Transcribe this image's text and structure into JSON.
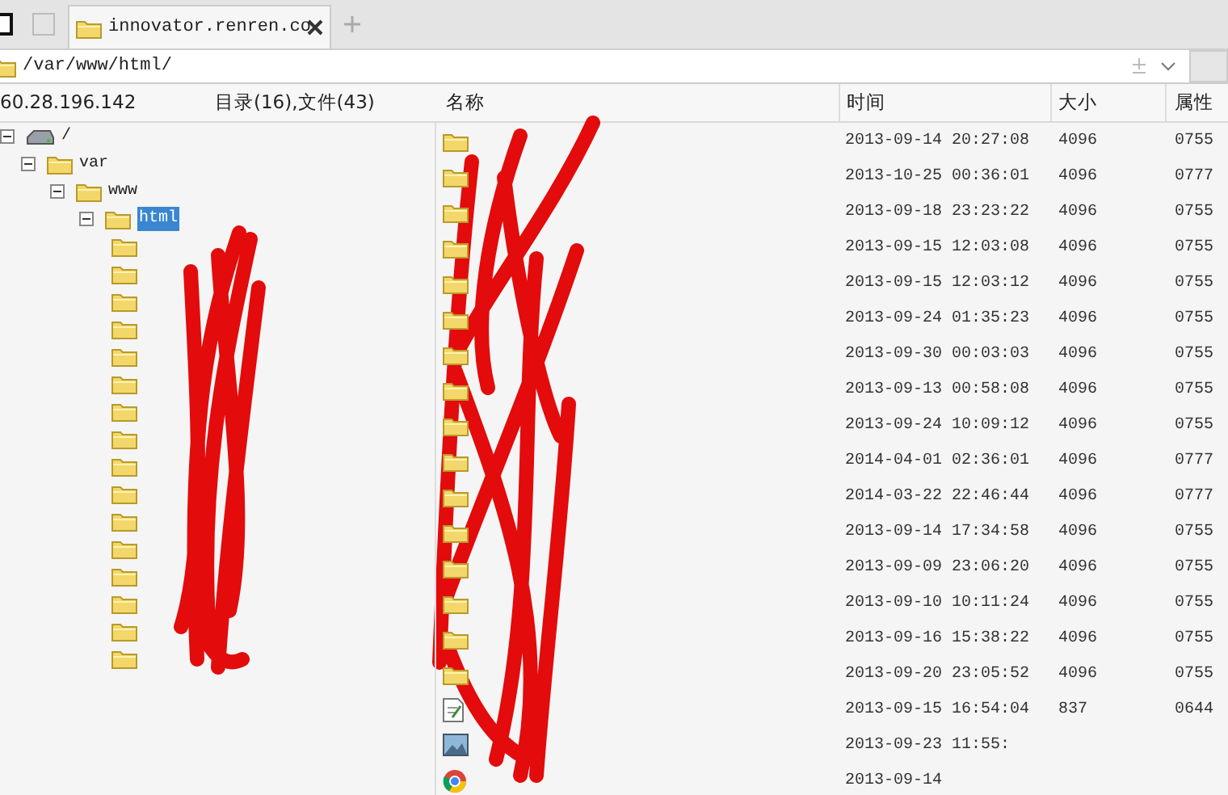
{
  "tabs": [
    {
      "label": "innovator.renren.co",
      "selected": true
    }
  ],
  "address": {
    "path": "/var/www/html/"
  },
  "left_pane": {
    "host": "60.28.196.142",
    "summary": "目录(16),文件(43)"
  },
  "tree": [
    {
      "label": "/",
      "kind": "drive",
      "expanded": true,
      "selected": false,
      "children": [
        {
          "label": "var",
          "kind": "folder",
          "expanded": true,
          "selected": false,
          "children": [
            {
              "label": "www",
              "kind": "folder",
              "expanded": true,
              "selected": false,
              "children": [
                {
                  "label": "html",
                  "kind": "folder",
                  "expanded": true,
                  "selected": true,
                  "children": [
                    {
                      "kind": "folder"
                    },
                    {
                      "kind": "folder"
                    },
                    {
                      "kind": "folder"
                    },
                    {
                      "kind": "folder"
                    },
                    {
                      "kind": "folder"
                    },
                    {
                      "kind": "folder"
                    },
                    {
                      "kind": "folder"
                    },
                    {
                      "kind": "folder"
                    },
                    {
                      "kind": "folder"
                    },
                    {
                      "kind": "folder"
                    },
                    {
                      "kind": "folder"
                    },
                    {
                      "kind": "folder"
                    },
                    {
                      "kind": "folder"
                    },
                    {
                      "kind": "folder"
                    },
                    {
                      "kind": "folder"
                    },
                    {
                      "kind": "folder"
                    }
                  ]
                }
              ]
            }
          ]
        }
      ]
    }
  ],
  "file_list": {
    "columns": [
      "名称",
      "时间",
      "大小",
      "属性"
    ],
    "rows": [
      {
        "kind": "folder",
        "time": "2013-09-14 20:27:08",
        "size": "4096",
        "attr": "0755"
      },
      {
        "kind": "folder",
        "time": "2013-10-25 00:36:01",
        "size": "4096",
        "attr": "0777"
      },
      {
        "kind": "folder",
        "time": "2013-09-18 23:23:22",
        "size": "4096",
        "attr": "0755"
      },
      {
        "kind": "folder",
        "time": "2013-09-15 12:03:08",
        "size": "4096",
        "attr": "0755"
      },
      {
        "kind": "folder",
        "time": "2013-09-15 12:03:12",
        "size": "4096",
        "attr": "0755"
      },
      {
        "kind": "folder",
        "time": "2013-09-24 01:35:23",
        "size": "4096",
        "attr": "0755"
      },
      {
        "kind": "folder",
        "time": "2013-09-30 00:03:03",
        "size": "4096",
        "attr": "0755"
      },
      {
        "kind": "folder",
        "time": "2013-09-13 00:58:08",
        "size": "4096",
        "attr": "0755"
      },
      {
        "kind": "folder",
        "time": "2013-09-24 10:09:12",
        "size": "4096",
        "attr": "0755"
      },
      {
        "kind": "folder",
        "time": "2014-04-01 02:36:01",
        "size": "4096",
        "attr": "0777"
      },
      {
        "kind": "folder",
        "time": "2014-03-22 22:46:44",
        "size": "4096",
        "attr": "0777"
      },
      {
        "kind": "folder",
        "time": "2013-09-14 17:34:58",
        "size": "4096",
        "attr": "0755"
      },
      {
        "kind": "folder",
        "time": "2013-09-09 23:06:20",
        "size": "4096",
        "attr": "0755"
      },
      {
        "kind": "folder",
        "time": "2013-09-10 10:11:24",
        "size": "4096",
        "attr": "0755"
      },
      {
        "kind": "folder",
        "time": "2013-09-16 15:38:22",
        "size": "4096",
        "attr": "0755"
      },
      {
        "kind": "folder",
        "time": "2013-09-20 23:05:52",
        "size": "4096",
        "attr": "0755"
      },
      {
        "kind": "text",
        "time": "2013-09-15 16:54:04",
        "size": "837",
        "attr": "0644"
      },
      {
        "kind": "image",
        "time": "2013-09-23 11:55:"
      },
      {
        "kind": "web",
        "time": "2013-09-14"
      }
    ]
  }
}
